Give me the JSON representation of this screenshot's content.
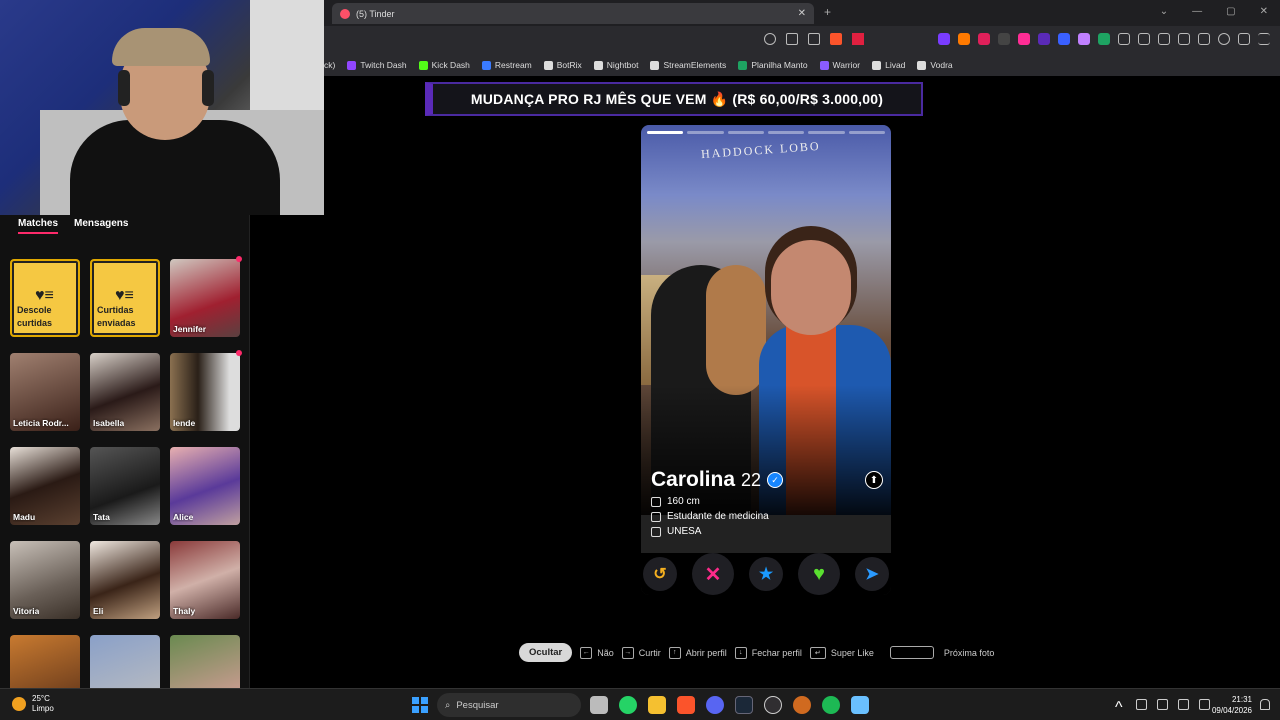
{
  "browser": {
    "tab_title": "(5) Tinder",
    "bookmarks": [
      {
        "label": "ck)",
        "color": ""
      },
      {
        "label": "Twitch Dash",
        "color": "#9146ff"
      },
      {
        "label": "Kick Dash",
        "color": "#53fc18"
      },
      {
        "label": "Restream",
        "color": "#3a7bff"
      },
      {
        "label": "BotRix",
        "color": "#dddddd"
      },
      {
        "label": "Nightbot",
        "color": "#dddddd"
      },
      {
        "label": "StreamElements",
        "color": "#dddddd"
      },
      {
        "label": "Planilha Manto",
        "color": "#1ea362"
      },
      {
        "label": "Warrior",
        "color": "#8a5cff"
      },
      {
        "label": "Livad",
        "color": "#dddddd"
      },
      {
        "label": "Vodra",
        "color": "#dddddd"
      }
    ]
  },
  "sidebar": {
    "tabs": [
      "Matches",
      "Mensagens"
    ],
    "gold_cards": [
      {
        "line1": "Descole",
        "line2": "curtidas"
      },
      {
        "line1": "Curtidas",
        "line2": "enviadas"
      }
    ],
    "matches": [
      "Jennifer",
      "Leticia Rodr...",
      "Isabella",
      "Iende",
      "Madu",
      "Tata",
      "Alice",
      "Vitoria",
      "Eli",
      "Thaly",
      "",
      "",
      ""
    ]
  },
  "banner": "MUDANÇA PRO RJ MÊS QUE VEM 🔥 (R$ 60,00/R$ 3.000,00)",
  "profile": {
    "photo_sign": "HADDOCK LOBO",
    "name": "Carolina",
    "age": "22",
    "height": "160 cm",
    "occupation": "Estudante de medicina",
    "school": "UNESA",
    "photo_count": 6,
    "current_photo": 1
  },
  "actions": {
    "rewind": "↺",
    "nope": "✕",
    "superlike": "★",
    "like": "♥",
    "boost": "➤"
  },
  "hints": {
    "hide": "Ocultar",
    "nope": "Não",
    "like": "Curtir",
    "open": "Abrir perfil",
    "close": "Fechar perfil",
    "superlike": "Super Like",
    "next_photo": "Próxima foto"
  },
  "taskbar": {
    "temperature": "25°C",
    "weather": "Limpo",
    "search": "Pesquisar",
    "time": "21:31",
    "date": "09/04/2026"
  },
  "colors": {
    "accent": "#fd2a6a",
    "gold": "#f5c842",
    "banner_border": "#5a2ab8"
  }
}
